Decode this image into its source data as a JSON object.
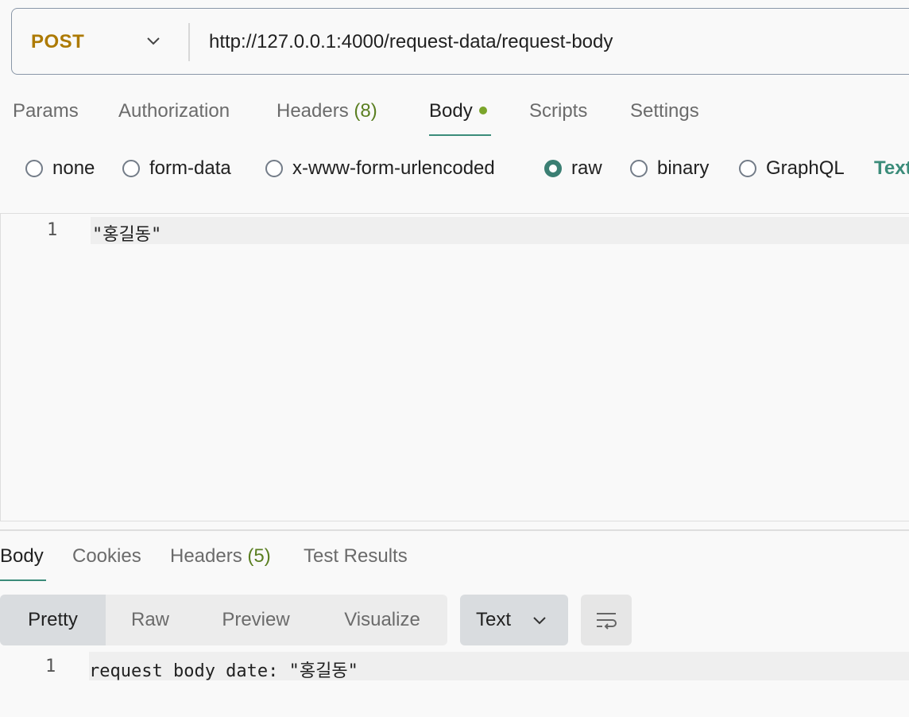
{
  "request": {
    "method": "POST",
    "url": "http://127.0.0.1:4000/request-data/request-body"
  },
  "request_tabs": [
    {
      "label": "Params"
    },
    {
      "label": "Authorization"
    },
    {
      "label": "Headers",
      "count": "(8)"
    },
    {
      "label": "Body",
      "active": true
    },
    {
      "label": "Scripts"
    },
    {
      "label": "Settings"
    }
  ],
  "body_types": [
    {
      "label": "none"
    },
    {
      "label": "form-data"
    },
    {
      "label": "x-www-form-urlencoded"
    },
    {
      "label": "raw",
      "selected": true
    },
    {
      "label": "binary"
    },
    {
      "label": "GraphQL"
    }
  ],
  "raw_format": "Text",
  "editor": {
    "line_number": "1",
    "content": "\"홍길동\""
  },
  "response_tabs": [
    {
      "label": "Body",
      "active": true
    },
    {
      "label": "Cookies"
    },
    {
      "label": "Headers",
      "count": "(5)"
    },
    {
      "label": "Test Results"
    }
  ],
  "view_modes": [
    {
      "label": "Pretty",
      "active": true
    },
    {
      "label": "Raw"
    },
    {
      "label": "Preview"
    },
    {
      "label": "Visualize"
    }
  ],
  "response_format": "Text",
  "response": {
    "line_number": "1",
    "content": "request body date: \"홍길동\""
  },
  "colors": {
    "method": "#ad7a03",
    "accent": "#3b8c7a",
    "count": "#5b7f22",
    "modified_dot": "#7ba52b"
  }
}
